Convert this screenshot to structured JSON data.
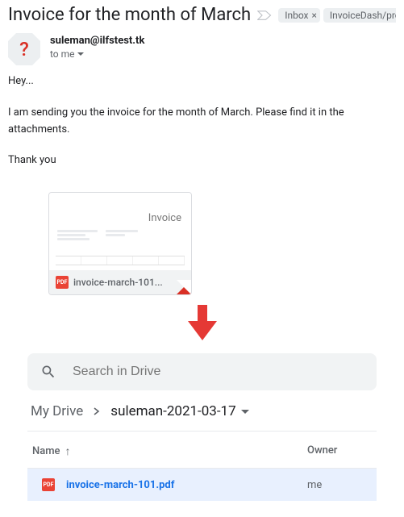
{
  "email": {
    "subject": "Invoice for the month of March",
    "labels": [
      {
        "name": "Inbox",
        "closable": true
      },
      {
        "name": "InvoiceDash/pro",
        "closable": true
      }
    ],
    "avatar_glyph": "?",
    "sender": "suleman@ilfstest.tk",
    "to_line": "to me",
    "body_lines": [
      "Hey...",
      "I am sending you the invoice for the month of March. Please find it in the attachments.",
      "Thank you"
    ],
    "attachment": {
      "type_badge": "PDF",
      "filename_trunc": "invoice-march-101...",
      "preview_title": "Invoice"
    }
  },
  "drive": {
    "search_placeholder": "Search in Drive",
    "breadcrumb_root": "My Drive",
    "breadcrumb_current": "suleman-2021-03-17",
    "columns": {
      "name": "Name",
      "owner": "Owner"
    },
    "file": {
      "type_badge": "PDF",
      "name": "invoice-march-101.pdf",
      "owner": "me"
    }
  }
}
